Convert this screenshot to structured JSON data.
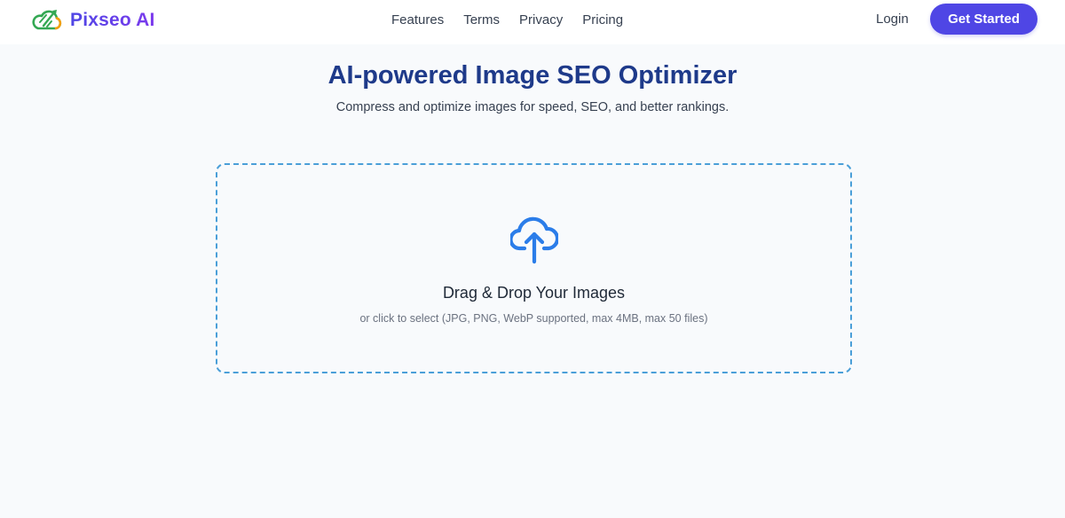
{
  "header": {
    "brand": {
      "name": "Pixseo AI",
      "logo_icon": "cloud-rocket-icon"
    },
    "nav": [
      {
        "label": "Features"
      },
      {
        "label": "Terms"
      },
      {
        "label": "Privacy"
      },
      {
        "label": "Pricing"
      }
    ],
    "login_label": "Login",
    "cta_label": "Get Started"
  },
  "hero": {
    "title": "AI-powered Image SEO Optimizer",
    "subtitle": "Compress and optimize images for speed, SEO, and better rankings."
  },
  "dropzone": {
    "icon": "cloud-upload-icon",
    "title": "Drag & Drop Your Images",
    "hint": "or click to select (JPG, PNG, WebP supported, max 4MB, max 50 files)"
  },
  "colors": {
    "accent": "#4f46e5",
    "brand_gradient_end": "#7c3aed",
    "title": "#1e3a8a",
    "dropzone_border": "#4a9fd8",
    "upload_icon": "#2b7de9",
    "logo_green": "#34a853",
    "logo_orange": "#f59e0b",
    "page_background": "#f8fafc"
  }
}
